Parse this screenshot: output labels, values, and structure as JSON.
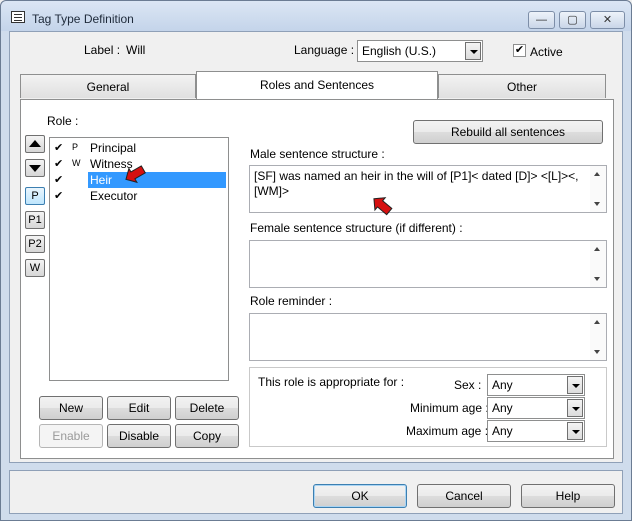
{
  "window": {
    "title": "Tag Type Definition",
    "minimize_glyph": "—",
    "maximize_glyph": "▢",
    "close_glyph": "✕"
  },
  "header": {
    "label_caption": "Label :",
    "label_value": "Will",
    "language_caption": "Language :",
    "language_value": "English (U.S.)",
    "active_label": "Active",
    "active_checked": true,
    "check_glyph": "✔"
  },
  "tabs": [
    {
      "label": "General",
      "active": false
    },
    {
      "label": "Roles and Sentences",
      "active": true
    },
    {
      "label": "Other",
      "active": false
    }
  ],
  "roles_panel": {
    "role_caption": "Role :",
    "side_buttons": [
      "P",
      "P1",
      "P2",
      "W"
    ],
    "roles": [
      {
        "check": "✔",
        "abbr": "P",
        "name": "Principal",
        "selected": false
      },
      {
        "check": "✔",
        "abbr": "W",
        "name": "Witness",
        "selected": false
      },
      {
        "check": "✔",
        "abbr": "",
        "name": "Heir",
        "selected": true
      },
      {
        "check": "✔",
        "abbr": "",
        "name": "Executor",
        "selected": false
      }
    ],
    "buttons": {
      "new": "New",
      "edit": "Edit",
      "delete": "Delete",
      "enable": "Enable",
      "disable": "Disable",
      "copy": "Copy"
    }
  },
  "sentences": {
    "rebuild_button": "Rebuild all sentences",
    "male_caption": "Male sentence structure :",
    "male_value": "[SF] was named an heir in the will of [P1]< dated [D]> <[L]><, [WM]>",
    "female_caption": "Female sentence structure (if different) :",
    "female_value": "",
    "reminder_caption": "Role reminder :",
    "reminder_value": ""
  },
  "appropriate": {
    "caption": "This role is appropriate for :",
    "sex_caption": "Sex :",
    "sex_value": "Any",
    "min_age_caption": "Minimum age :",
    "min_age_value": "Any",
    "max_age_caption": "Maximum age :",
    "max_age_value": "Any"
  },
  "footer": {
    "ok": "OK",
    "cancel": "Cancel",
    "help": "Help"
  },
  "colors": {
    "selection": "#3399ff",
    "annotation_arrow": "#d61010"
  }
}
